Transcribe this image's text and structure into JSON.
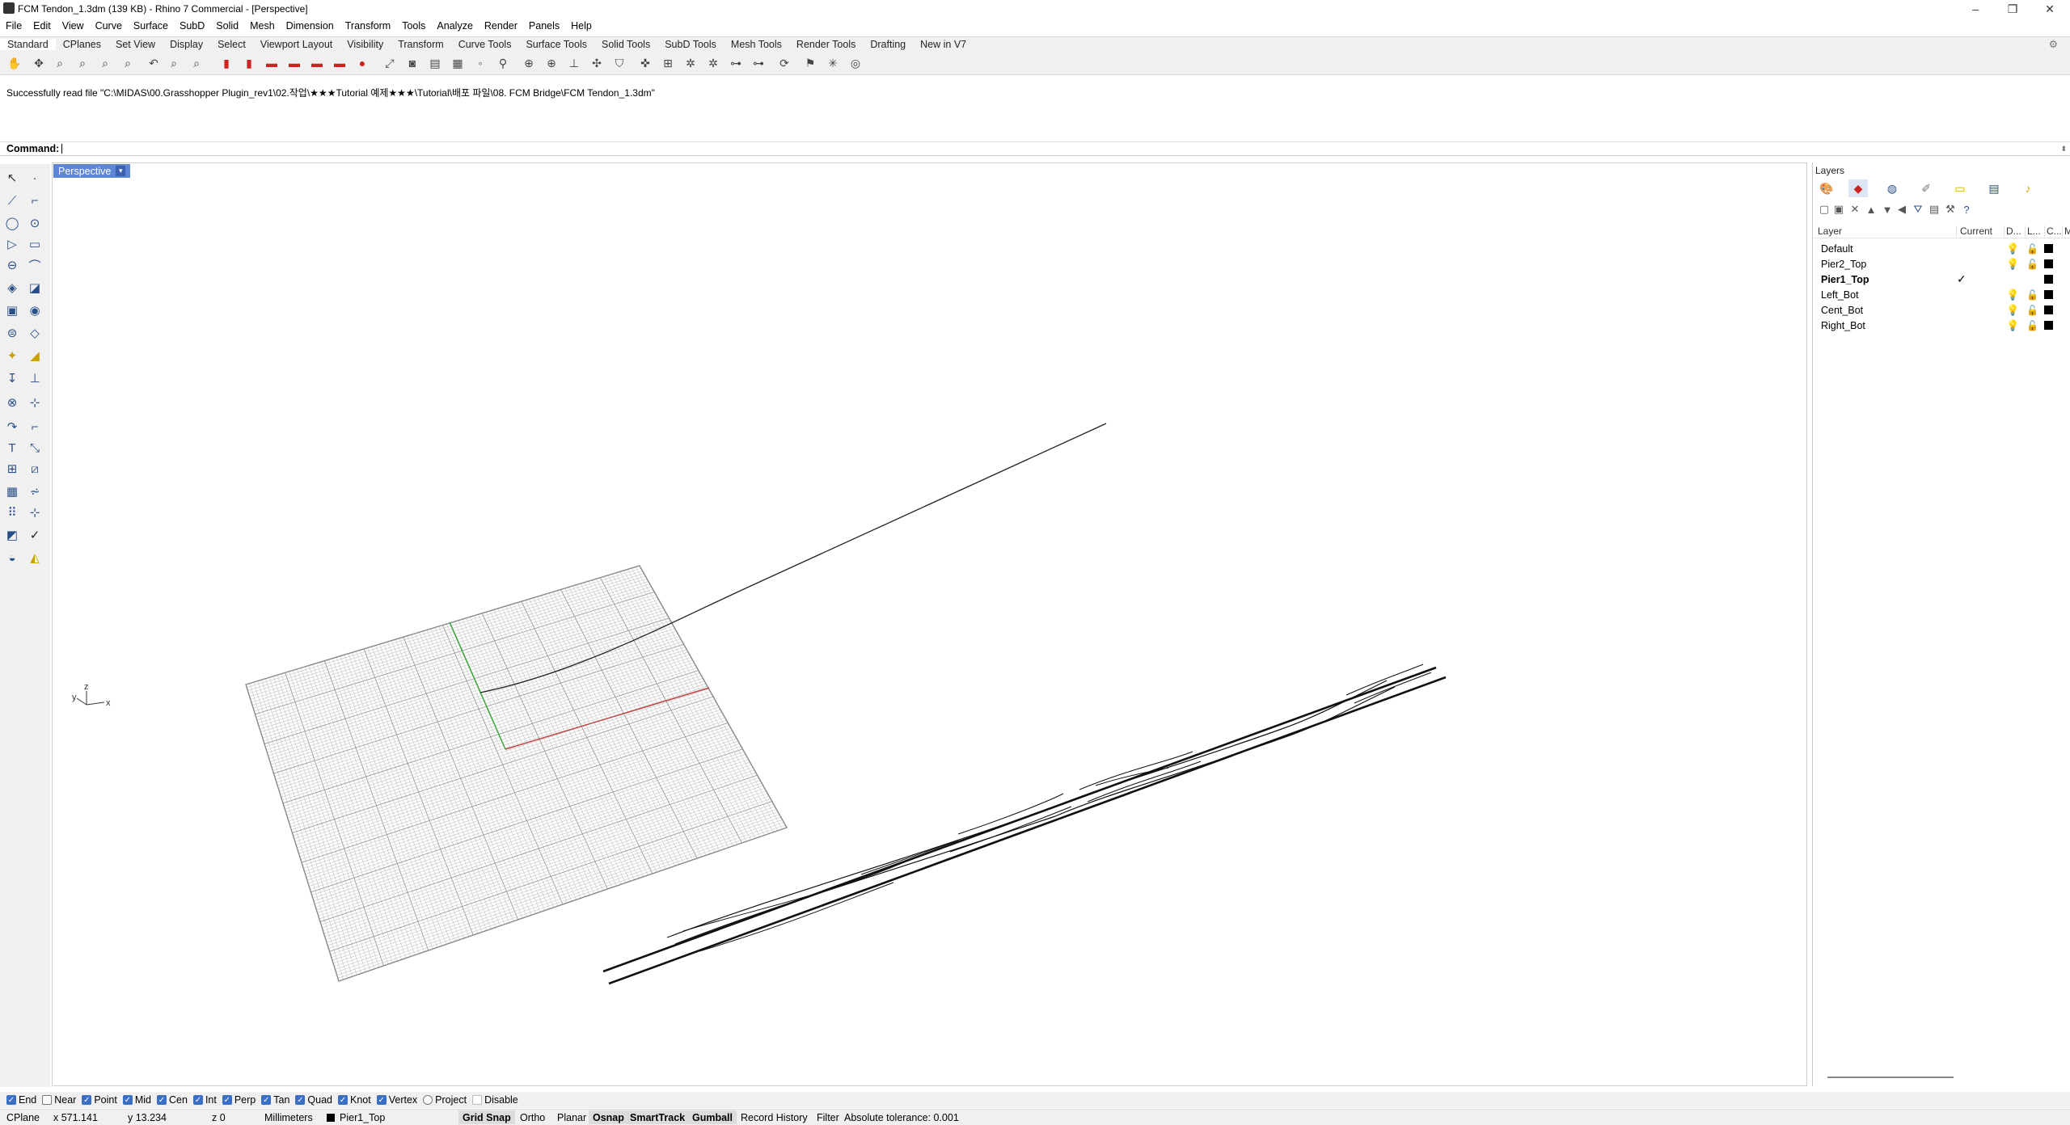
{
  "window": {
    "title": "FCM Tendon_1.3dm (139 KB) - Rhino 7 Commercial - [Perspective]",
    "minimize": "–",
    "maximize": "❐",
    "close": "✕"
  },
  "menu": [
    "File",
    "Edit",
    "View",
    "Curve",
    "Surface",
    "SubD",
    "Solid",
    "Mesh",
    "Dimension",
    "Transform",
    "Tools",
    "Analyze",
    "Render",
    "Panels",
    "Help"
  ],
  "toolbar_tabs": [
    "Standard",
    "CPlanes",
    "Set View",
    "Display",
    "Select",
    "Viewport Layout",
    "Visibility",
    "Transform",
    "Curve Tools",
    "Surface Tools",
    "Solid Tools",
    "SubD Tools",
    "Mesh Tools",
    "Render Tools",
    "Drafting",
    "New in V7"
  ],
  "history_text": "Successfully read file \"C:\\MIDAS\\00.Grasshopper Plugin_rev1\\02.작업\\★★★Tutorial 예제★★★\\Tutorial\\배포 파일\\08. FCM Bridge\\FCM Tendon_1.3dm\"",
  "command": {
    "label": "Command:",
    "value": ""
  },
  "viewport": {
    "name": "Perspective",
    "axis_x": "x",
    "axis_z": "z",
    "axis_y": "y"
  },
  "layers_panel": {
    "title": "Layers",
    "columns": {
      "layer": "Layer",
      "current": "Current",
      "c1": "D...",
      "c2": "L...",
      "c3": "C...",
      "c4": "M"
    },
    "rows": [
      {
        "name": "Default",
        "current": "",
        "bold": false
      },
      {
        "name": "Pier2_Top",
        "current": "",
        "bold": false
      },
      {
        "name": "Pier1_Top",
        "current": "✓",
        "bold": true
      },
      {
        "name": "Left_Bot",
        "current": "",
        "bold": false
      },
      {
        "name": "Cent_Bot",
        "current": "",
        "bold": false
      },
      {
        "name": "Right_Bot",
        "current": "",
        "bold": false
      }
    ]
  },
  "osnap": [
    {
      "label": "End",
      "checked": true
    },
    {
      "label": "Near",
      "checked": false
    },
    {
      "label": "Point",
      "checked": true
    },
    {
      "label": "Mid",
      "checked": true
    },
    {
      "label": "Cen",
      "checked": true
    },
    {
      "label": "Int",
      "checked": true
    },
    {
      "label": "Perp",
      "checked": true
    },
    {
      "label": "Tan",
      "checked": true
    },
    {
      "label": "Quad",
      "checked": true
    },
    {
      "label": "Knot",
      "checked": true
    },
    {
      "label": "Vertex",
      "checked": true
    },
    {
      "label": "Project",
      "checked": false
    },
    {
      "label": "Disable",
      "checked": false
    }
  ],
  "status": {
    "cplane": "CPlane",
    "x": "x 571.141",
    "y": "y 13.234",
    "z": "z 0",
    "units": "Millimeters",
    "layer": "Pier1_Top",
    "grid_snap": "Grid Snap",
    "ortho": "Ortho",
    "planar": "Planar",
    "osnap": "Osnap",
    "smarttrack": "SmartTrack",
    "gumball": "Gumball",
    "record_history": "Record History",
    "filter": "Filter",
    "tolerance": "Absolute tolerance: 0.001"
  }
}
